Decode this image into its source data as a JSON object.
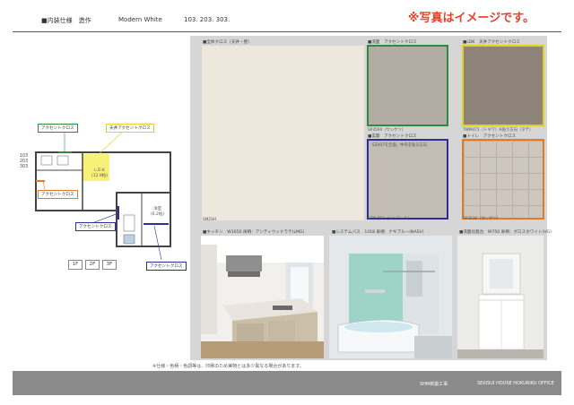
{
  "header": {
    "section": "■内装仕様　造作",
    "theme": "Modern  White",
    "rooms": "103. 203. 303."
  },
  "notice": "※写真はイメージです。",
  "swatches": {
    "main": {
      "label": "■全体クロス（天井・壁）",
      "code": "SM2SH",
      "color": "#ede7de"
    },
    "washroom": {
      "label": "■洗面　アクセントクロス",
      "code": "SP3594（サンゲツ）",
      "color": "#b3aca5",
      "border": "#2e8b3e"
    },
    "ldk": {
      "label": "■LDK　天井アクセントクロス",
      "code": "TWM471（トキワ）※貼り方向（タテ）",
      "color": "#8e8479",
      "border": "#e2d21f"
    },
    "entrance": {
      "label": "■玄関　アクセントクロス",
      "note": "SZ407を全面、中央を貼る方向",
      "code": "STM-703（シンコール）",
      "color": "#c2bcb5",
      "border": "#2a2f9a"
    },
    "toilet": {
      "label": "■トイレ　アクセントクロス",
      "code": "SP3536（サンゲツ）",
      "color": "#cec7c0",
      "border": "#e27b24"
    }
  },
  "photos": {
    "kitchen": {
      "label": "■キッチン　W1650 扉柄：アンティウッドラテ(LMG)"
    },
    "bath": {
      "label": "■システムバス　1418 扉柄：ナギブルー(NASV)"
    },
    "vanity": {
      "label": "■洗面化粧台　W750 扉柄：グロスホワイト(VG)"
    }
  },
  "floorplan": {
    "room_label": "103\n203\n303",
    "ldk_label": "L.D.K",
    "ldk_size": "(12.9帖)",
    "western_label": "洋室",
    "western_size": "(6.2帖)",
    "callouts": {
      "washroom": "アクセントクロス",
      "ldk": "天井アクセントクロス",
      "entrance": "アクセントクロス",
      "toilet": "アクセントクロス",
      "bottom": "アクセントクロス"
    },
    "floors": [
      "1F",
      "2F",
      "3F"
    ]
  },
  "disclaimer": "※仕様・色柄・色調等は、印刷のため実物とは多少異なる場合があります。",
  "footer": {
    "company": "SHM新築工事",
    "office": "SEKISUI HOUSE HOKURIKU OFFICE"
  }
}
